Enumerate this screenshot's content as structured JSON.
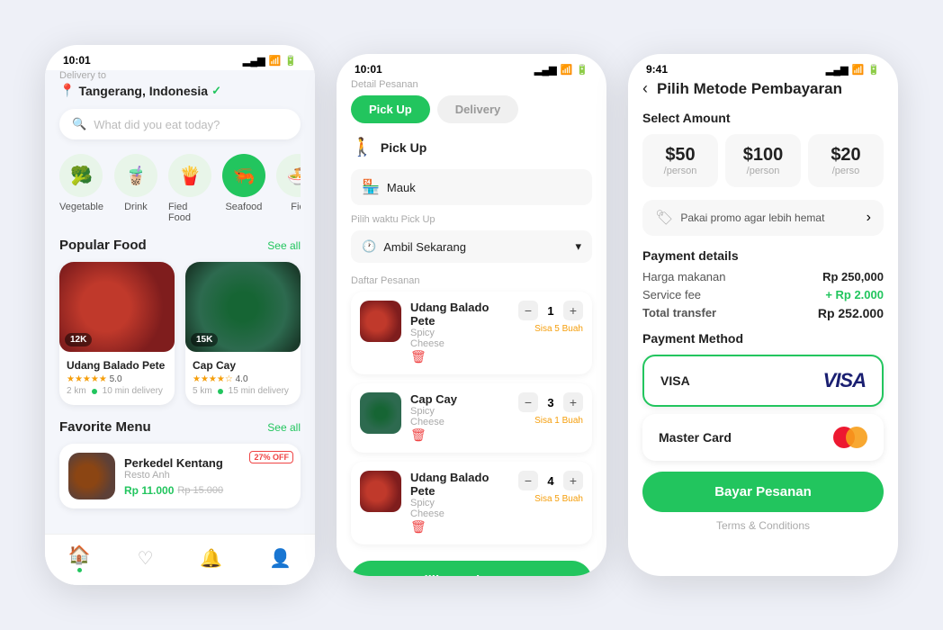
{
  "screen1": {
    "status_time": "10:01",
    "delivery_label": "Delivery to",
    "location": "Tangerang, Indonesia",
    "search_placeholder": "What did you eat today?",
    "categories": [
      {
        "id": "veg",
        "label": "Vegetable",
        "icon": "🥦",
        "active": false
      },
      {
        "id": "drink",
        "label": "Drink",
        "icon": "🧋",
        "active": false
      },
      {
        "id": "fried",
        "label": "Fied Food",
        "icon": "🍟",
        "active": false
      },
      {
        "id": "seafood",
        "label": "Seafood",
        "icon": "🦐",
        "active": true
      },
      {
        "id": "fie",
        "label": "Fie",
        "icon": "🍜",
        "active": false
      }
    ],
    "popular_title": "Popular Food",
    "see_all_1": "See all",
    "foods": [
      {
        "name": "Udang Balado Pete",
        "badge": "12K",
        "rating": "5.0",
        "distance": "2 km",
        "time": "10 min delivery"
      },
      {
        "name": "Cap Cay",
        "badge": "15K",
        "rating": "4.0",
        "distance": "5 km",
        "time": "15 min delivery"
      }
    ],
    "favorite_title": "Favorite Menu",
    "see_all_2": "See all",
    "favorites": [
      {
        "name": "Perkedel Kentang",
        "restaurant": "Resto Anh",
        "price": "Rp 11.000",
        "old_price": "Rp 15.000",
        "discount": "27% OFF"
      }
    ]
  },
  "screen2": {
    "status_time": "10:01",
    "section_label": "Detail Pesanan",
    "tab_pickup": "Pick Up",
    "tab_delivery": "Delivery",
    "pickup_label": "Pick Up",
    "location_value": "Mauk",
    "time_label": "Pilih waktu Pick Up",
    "time_value": "Ambil Sekarang",
    "orders_label": "Daftar Pesanan",
    "orders": [
      {
        "name": "Udang Balado Pete",
        "desc1": "Spicy",
        "desc2": "Cheese",
        "qty": 1,
        "stock_warn": "Sisa 5 Buah"
      },
      {
        "name": "Cap Cay",
        "desc1": "Spicy",
        "desc2": "Cheese",
        "qty": 3,
        "stock_warn": "Sisa 1 Buah"
      },
      {
        "name": "Udang Balado Pete",
        "desc1": "Spicy",
        "desc2": "Cheese",
        "qty": 4,
        "stock_warn": "Sisa 5 Buah"
      }
    ],
    "pay_btn": "Pilih Pembayaran"
  },
  "screen3": {
    "status_time": "9:41",
    "back_icon": "‹",
    "title": "Pilih Metode Pembayaran",
    "select_amount_label": "Select Amount",
    "amounts": [
      {
        "value": "$50",
        "per": "/person",
        "active": false
      },
      {
        "value": "$100",
        "per": "/person",
        "active": false
      },
      {
        "value": "$20",
        "per": "/perso",
        "active": false
      }
    ],
    "promo_text": "Pakai promo agar lebih hemat",
    "payment_details_label": "Payment details",
    "details": [
      {
        "label": "Harga makanan",
        "value": "Rp 250,000",
        "type": "normal"
      },
      {
        "label": "Service fee",
        "value": "+ Rp 2.000",
        "type": "green"
      },
      {
        "label": "Total transfer",
        "value": "Rp 252.000",
        "type": "bold"
      }
    ],
    "payment_method_label": "Payment Method",
    "methods": [
      {
        "name": "VISA",
        "type": "visa",
        "active": true
      },
      {
        "name": "Master Card",
        "type": "mastercard",
        "active": false
      }
    ],
    "pay_btn": "Bayar Pesanan",
    "terms": "Terms & Conditions"
  }
}
